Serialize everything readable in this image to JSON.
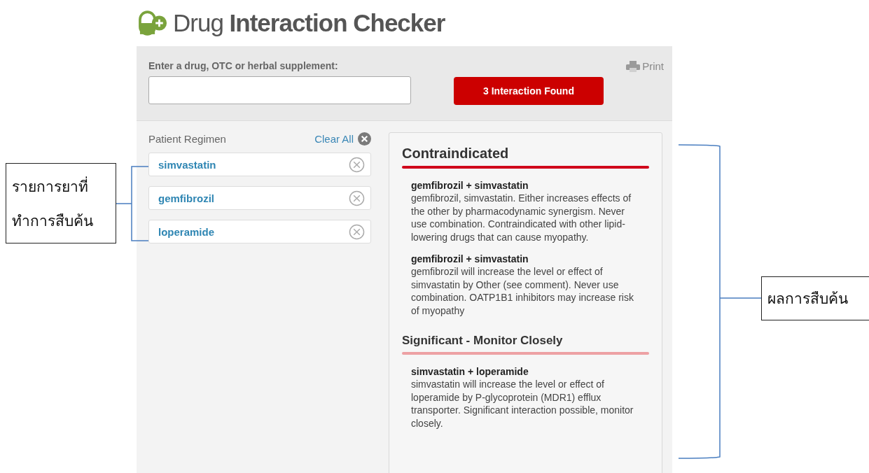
{
  "header": {
    "title": "Drug **Interaction Checker**"
  },
  "search": {
    "label": "Enter a drug, OTC or herbal supplement:",
    "button": "3 Interaction Found",
    "print": "Print"
  },
  "regimen": {
    "title": "Patient Regimen",
    "clear": "Clear All",
    "drugs": [
      "simvastatin",
      "gemfibrozil",
      "loperamide"
    ]
  },
  "results": [
    {
      "heading": "Contraindicated",
      "kind": "major",
      "color": "#d0021b",
      "items": [
        {
          "title": "gemfibrozil + simvastatin",
          "text": "gemfibrozil, simvastatin. Either increases effects of the other by pharmacodynamic synergism. Never use combination. Contraindicated with other lipid-lowering drugs that can cause myopathy."
        },
        {
          "title": "gemfibrozil + simvastatin",
          "text": "gemfibrozil will increase the level or effect of simvastatin by Other (see comment). Never use combination. OATP1B1 inhibitors may increase risk of myopathy"
        }
      ]
    },
    {
      "heading": "Significant - Monitor Closely",
      "kind": "minor",
      "color": "#eda1a4",
      "items": [
        {
          "title": "simvastatin + loperamide",
          "text": "simvastatin will increase the level or effect of loperamide by P-glycoprotein (MDR1) efflux transporter. Significant interaction possible, monitor closely."
        }
      ]
    }
  ],
  "annotations": [
    {
      "lines": [
        "รายการยาที่",
        "ทำการสืบค้น"
      ]
    },
    {
      "lines": [
        "ผลการสืบค้น"
      ]
    }
  ]
}
